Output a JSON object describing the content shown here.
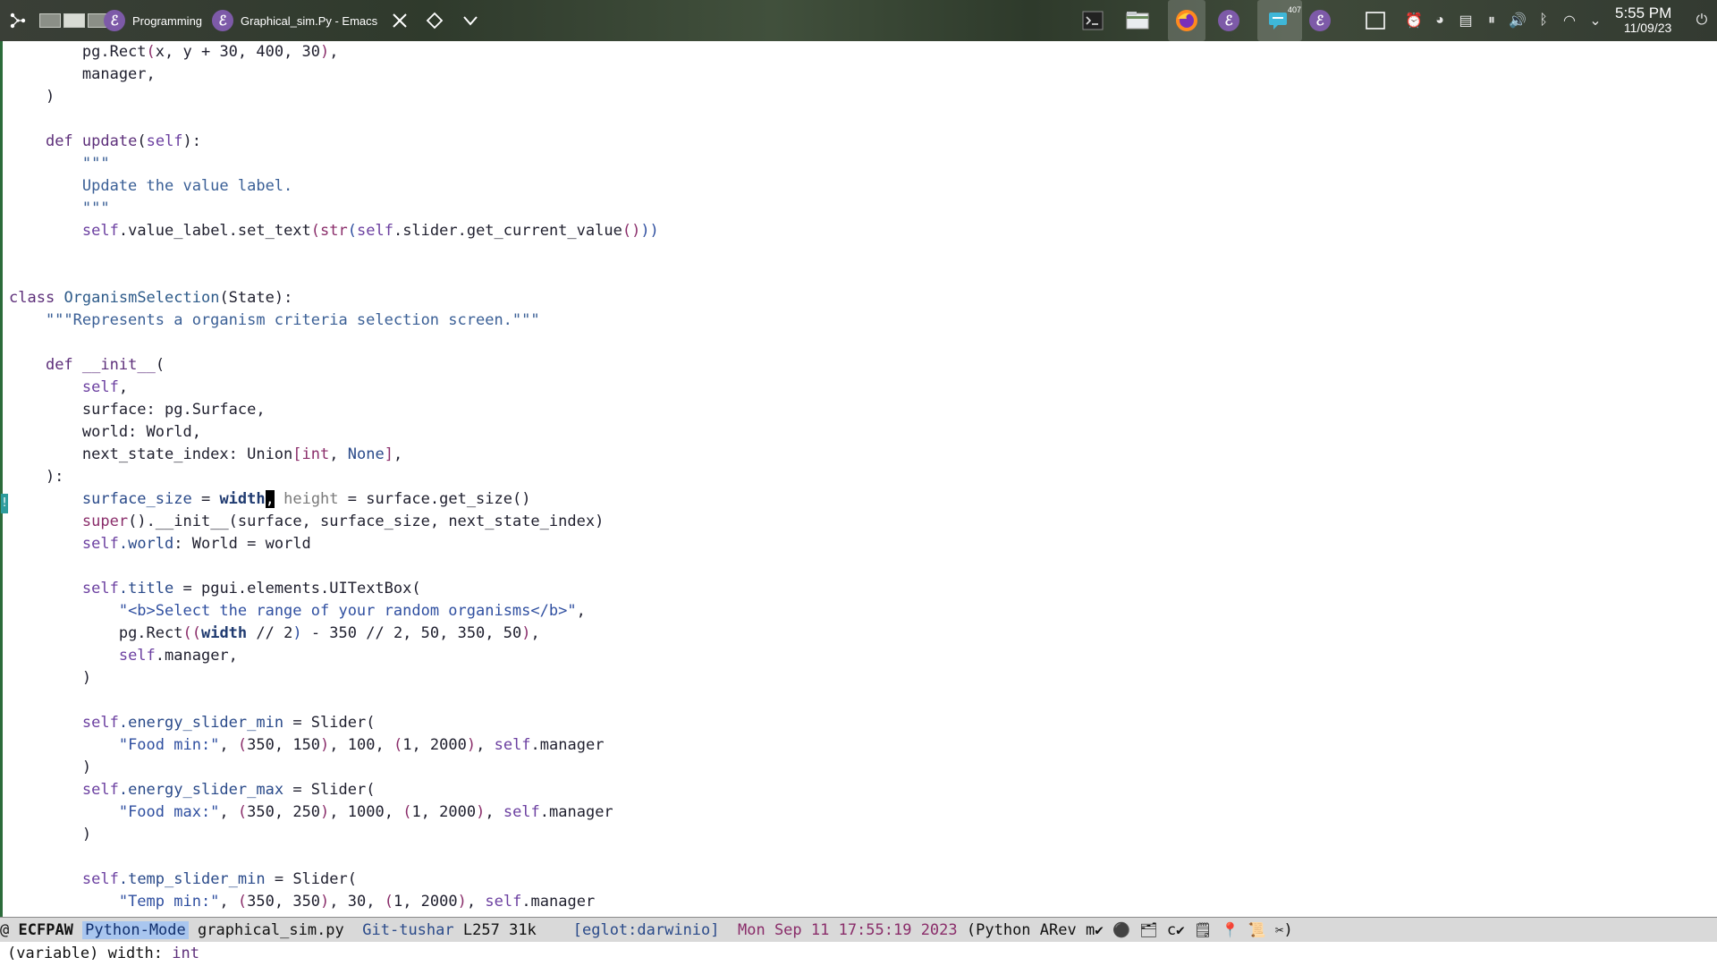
{
  "taskbar": {
    "programming_label": "Programming",
    "window_title": "Graphical_sim.Py - Emacs",
    "notification_count": "407",
    "clock_time": "5:55 PM",
    "clock_date": "11/09/23",
    "emacs_glyph": "ℰ",
    "icons": [
      "launcher-icon",
      "pager-icon",
      "close-icon",
      "diamond-icon",
      "chevron-down-icon",
      "terminal-icon",
      "file-manager-icon",
      "firefox-icon",
      "emacs-icon",
      "chat-icon",
      "desktop-icon",
      "alarm-icon",
      "color-icon",
      "clipboard-icon",
      "media-pause-icon",
      "volume-icon",
      "bluetooth-icon",
      "wifi-icon",
      "expand-tray-icon",
      "power-icon"
    ]
  },
  "code": {
    "l1": {
      "indent": "        ",
      "a": "pg.Rect",
      "b": "(",
      "c": "x, y + 30, 400, 30",
      "d": ")",
      "e": ","
    },
    "l2": "        manager,",
    "l3": "    )",
    "l5": {
      "indent": "    ",
      "kw": "def",
      "fn": "update",
      "p1": "(",
      "self": "self",
      "p2": "):"
    },
    "l6": "        \"\"\"",
    "l7": "        Update the value label.",
    "l8": "        \"\"\"",
    "l9": {
      "self": "self",
      "a": ".value_label.set_text",
      "p1": "(",
      "bt": "str",
      "p2": "(",
      "self2": "self",
      "b": ".slider.get_current_value",
      "p3": "()",
      "p4": "))"
    },
    "l12": {
      "kw": "class",
      "cls": "OrganismSelection",
      "rest": "(State):"
    },
    "l13": "    \"\"\"Represents a organism criteria selection screen.\"\"\"",
    "l15": {
      "kw": "def",
      "fn": "__init__",
      "rest": "("
    },
    "l16": "self",
    "l16_comma": ",",
    "l17": "        surface: pg.Surface,",
    "l18": "        world: World,",
    "l19": {
      "a": "        next_state_index: Union",
      "p1": "[",
      "t1": "int",
      "c": ", ",
      "t2": "None",
      "p2": "]",
      "e": ","
    },
    "l20": "    ):",
    "l21": {
      "var": "surface_size",
      "eq": " = ",
      "w": "width",
      "cur": ",",
      "h": " height",
      "rest": " = surface.get_size()"
    },
    "l22": {
      "bt": "super",
      "p": "()",
      "rest": ".__init__(surface, surface_size, next_state_index)"
    },
    "l23": {
      "self": "self",
      "attr": ".world",
      "rest": ": World = world"
    },
    "l25": {
      "self": "self",
      "attr": ".title",
      "rest": " = pgui.elements.UITextBox("
    },
    "l26": "\"<b>Select the range of your random organisms</b>\"",
    "l26_comma": ",",
    "l27": {
      "a": "pg.Rect",
      "p1": "((",
      "w": "width",
      "b": " // 2",
      "p2": ")",
      "rest": " - 350 // 2, 50, 350, 50",
      "p3": ")",
      "e": ","
    },
    "l28": {
      "self": "self",
      "rest": ".manager,"
    },
    "l29": "        )",
    "l31": {
      "self": "self",
      "attr": ".energy_slider_min",
      "rest": " = Slider("
    },
    "l32": {
      "str": "\"Food min:\"",
      "a": ", ",
      "p1": "(",
      "b": "350, 150",
      "p2": ")",
      "c": ", 100, ",
      "p3": "(",
      "d": "1, 2000",
      "p4": ")",
      "e": ", ",
      "self": "self",
      "f": ".manager"
    },
    "l33": "        )",
    "l34": {
      "self": "self",
      "attr": ".energy_slider_max",
      "rest": " = Slider("
    },
    "l35": {
      "str": "\"Food max:\"",
      "a": ", ",
      "p1": "(",
      "b": "350, 250",
      "p2": ")",
      "c": ", 1000, ",
      "p3": "(",
      "d": "1, 2000",
      "p4": ")",
      "e": ", ",
      "self": "self",
      "f": ".manager"
    },
    "l36": "        )",
    "l38": {
      "self": "self",
      "attr": ".temp_slider_min",
      "rest": " = Slider("
    },
    "l39": {
      "str": "\"Temp min:\"",
      "a": ", ",
      "p1": "(",
      "b": "350, 350",
      "p2": ")",
      "c": ", 30, ",
      "p3": "(",
      "d": "1, 2000",
      "p4": ")",
      "e": ", ",
      "self": "self",
      "f": ".manager"
    }
  },
  "fringe": {
    "diagnostic_mark": "!"
  },
  "modeline": {
    "at": "@",
    "flags": "ECFPAW",
    "major_mode": "Python-Mode",
    "buffer": "graphical_sim.py",
    "git": "Git-tushar",
    "position": "L257",
    "size": "31k",
    "eglot": "[eglot:darwinio]",
    "datetime": "Mon Sep 11 17:55:19 2023",
    "minor_modes": "(Python ARev m",
    "check": "✔",
    "c": "c",
    "close_paren": ")"
  },
  "echo": {
    "prefix": "(variable) width: ",
    "type": "int"
  }
}
